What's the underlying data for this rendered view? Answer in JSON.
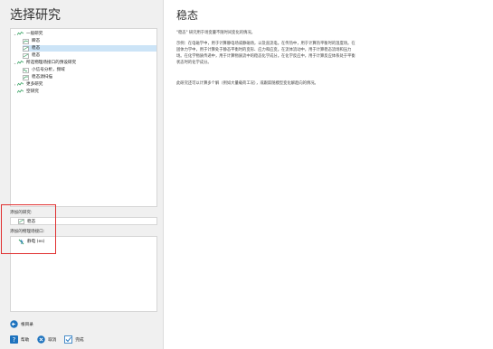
{
  "left": {
    "title": "选择研究",
    "tree": [
      {
        "label": "一般研究",
        "expanded": true
      },
      {
        "label": "瞬态"
      },
      {
        "label": "稳态",
        "selected": true
      },
      {
        "label": "稳态"
      },
      {
        "label": "所选物理场接口的预设研究",
        "expanded": true
      },
      {
        "label": "小信号分析，频域"
      },
      {
        "label": "稳态源扫描"
      },
      {
        "label": "更多研究",
        "expanded": false
      },
      {
        "label": "空研究"
      }
    ],
    "added_studies_label": "添加的研究:",
    "added_study": "稳态",
    "added_physics_label": "添加的物理场接口:",
    "added_physics": "静电 (es)"
  },
  "bottom": {
    "nav_label": "根目录",
    "help_label": "帮助",
    "cancel_label": "取消",
    "done_label": "完成"
  },
  "right": {
    "title": "稳态",
    "paragraph1": "\"稳态\" 研究用于场变量不随时间变化的情况。",
    "paragraph2": "示例：在电磁学中，用于计算静电场或静磁场，以及直流电。在传热中，用于计算热平衡时的温度场。在固体力学中，用于计算处于静态平衡时的变形、应力和应变。在流体流动中，用于计算稳态流场和压力场。在化学物质传递中，用于计算物质流中的稳态化学成分。在化学反应中，用于计算反应体系处于平衡状态时的化学成分。",
    "paragraph3": "此研究还可以计算多个解（例如大量载荷工况），或跟踪随模型变化解趋向的情况。"
  },
  "colors": {
    "selected_row": "#cce4f7",
    "highlight_outline": "#e03030",
    "study_icon_green": "#2e9e5b",
    "nav_blue": "#1e73be"
  }
}
